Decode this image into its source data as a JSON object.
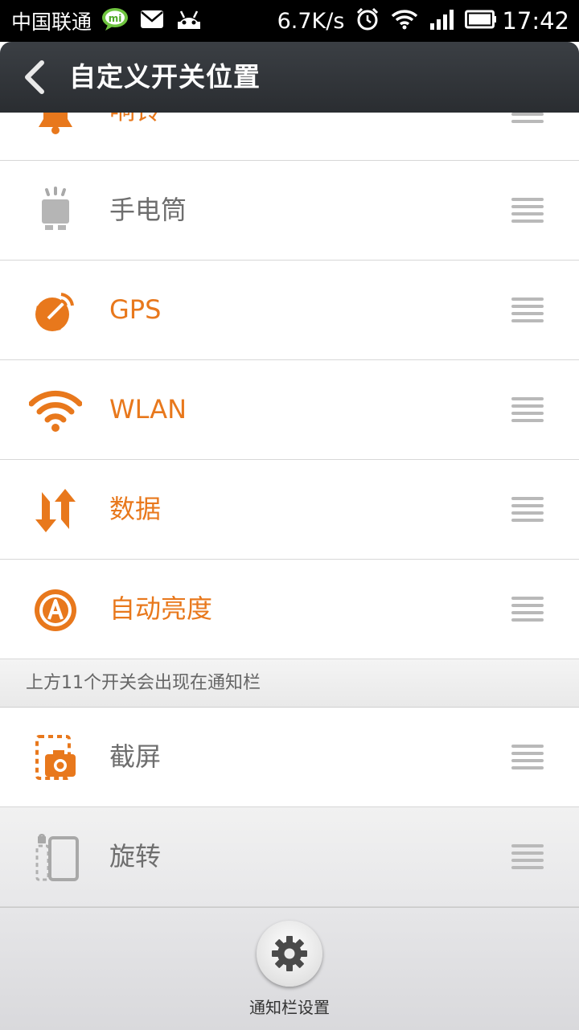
{
  "status_bar": {
    "carrier": "中国联通",
    "speed": "6.7K/s",
    "time": "17:42",
    "icons": [
      "mi-chat-icon",
      "mail-icon",
      "android-icon",
      "alarm-icon",
      "wifi-icon",
      "signal-icon",
      "battery-icon"
    ]
  },
  "header": {
    "title": "自定义开关位置"
  },
  "items": [
    {
      "label": "响铃",
      "icon": "bell-icon"
    },
    {
      "label": "手电筒",
      "icon": "flashlight-icon"
    },
    {
      "label": "GPS",
      "icon": "gps-icon"
    },
    {
      "label": "WLAN",
      "icon": "wlan-icon"
    },
    {
      "label": "数据",
      "icon": "data-icon"
    },
    {
      "label": "自动亮度",
      "icon": "auto-brightness-icon"
    }
  ],
  "section_note": "上方11个开关会出现在通知栏",
  "extra_items": [
    {
      "label": "截屏",
      "icon": "screenshot-icon"
    },
    {
      "label": "旋转",
      "icon": "rotate-lock-icon"
    }
  ],
  "bottom": {
    "button_label": "通知栏设置",
    "icon": "gear-icon"
  },
  "colors": {
    "accent": "#e8781c",
    "header_bg": "#33373b",
    "disabled_text": "#6e6e6e"
  }
}
